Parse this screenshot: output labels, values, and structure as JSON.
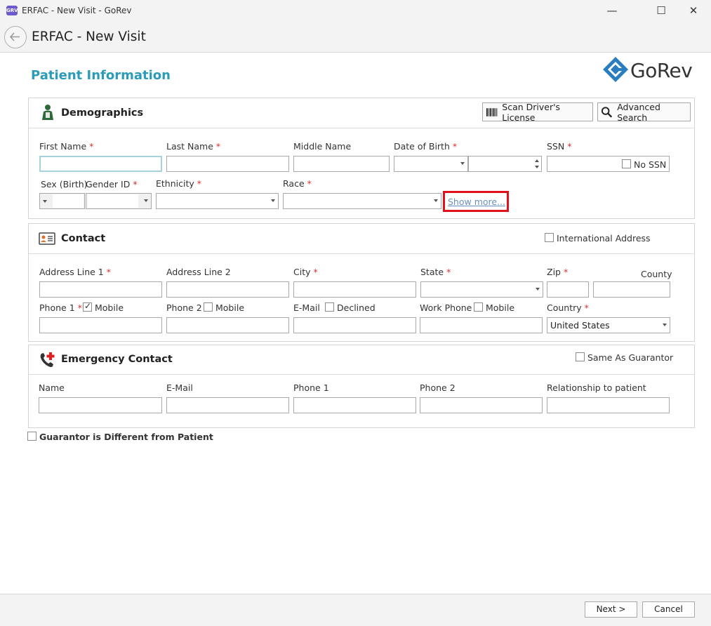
{
  "window": {
    "title": "ERFAC - New Visit - GoRev",
    "icon_label": "GRV",
    "minimize": "—",
    "maximize": "☐",
    "close": "✕"
  },
  "header": {
    "title": "ERFAC - New Visit"
  },
  "page": {
    "section_title": "Patient Information",
    "logo_text": "GoRev"
  },
  "demographics": {
    "title": "Demographics",
    "scan_button": "Scan Driver's License",
    "search_button": "Advanced Search",
    "first_name": "First Name",
    "last_name": "Last Name",
    "middle_name": "Middle Name",
    "dob": "Date of Birth",
    "ssn": "SSN",
    "no_ssn": "No SSN",
    "sex": "Sex (Birth)",
    "gender": "Gender ID",
    "ethnicity": "Ethnicity",
    "race": "Race",
    "show_more": "Show more..."
  },
  "contact": {
    "title": "Contact",
    "international": "International Address",
    "address1": "Address Line 1",
    "address2": "Address Line 2",
    "city": "City",
    "state": "State",
    "zip": "Zip",
    "county": "County",
    "phone1": "Phone 1",
    "mobile": "Mobile",
    "phone2": "Phone 2",
    "email": "E-Mail",
    "declined": "Declined",
    "work_phone": "Work Phone",
    "country": "Country",
    "country_value": "United States"
  },
  "emergency": {
    "title": "Emergency Contact",
    "same_as_guarantor": "Same As Guarantor",
    "name": "Name",
    "email": "E-Mail",
    "phone1": "Phone 1",
    "phone2": "Phone 2",
    "relationship": "Relationship to patient"
  },
  "guarantor_diff": "Guarantor is Different from Patient",
  "required_mark": "*",
  "footer": {
    "next": "Next >",
    "cancel": "Cancel"
  }
}
